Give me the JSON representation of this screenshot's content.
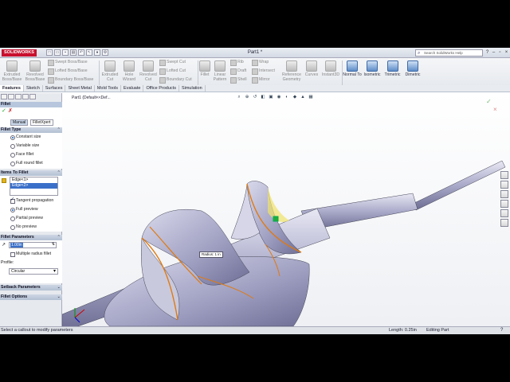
{
  "window": {
    "brand": "SOLIDWORKS",
    "doc_title": "Part1 *",
    "search_placeholder": "Search SolidWorks Help"
  },
  "ribbon": {
    "extruded_boss": "Extruded Boss/Base",
    "revolved_boss": "Revolved Boss/Base",
    "swept_boss": "Swept Boss/Base",
    "lofted_boss": "Lofted Boss/Base",
    "boundary_boss": "Boundary Boss/Base",
    "extruded_cut": "Extruded Cut",
    "hole_wizard": "Hole Wizard",
    "revolved_cut": "Revolved Cut",
    "swept_cut": "Swept Cut",
    "lofted_cut": "Lofted Cut",
    "boundary_cut": "Boundary Cut",
    "fillet": "Fillet",
    "linear_pattern": "Linear Pattern",
    "rib": "Rib",
    "draft": "Draft",
    "shell": "Shell",
    "wrap": "Wrap",
    "intersect": "Intersect",
    "mirror": "Mirror",
    "reference_geometry": "Reference Geometry",
    "curves": "Curves",
    "instant3d": "Instant3D",
    "normal_to": "Normal To",
    "isometric": "Isometric",
    "trimetric": "Trimetric",
    "dimetric": "Dimetric"
  },
  "tabs": [
    "Features",
    "Sketch",
    "Surfaces",
    "Sheet Metal",
    "Mold Tools",
    "Evaluate",
    "Office Products",
    "Simulation"
  ],
  "tree_label": "Part1 (Default<<Def...",
  "panel": {
    "title": "Fillet",
    "manual": "Manual",
    "filletxpert": "FilletXpert",
    "fillet_type": {
      "header": "Fillet Type",
      "options": [
        "Constant size",
        "Variable size",
        "Face fillet",
        "Full round fillet"
      ]
    },
    "items": {
      "header": "Items To Fillet",
      "edges": [
        "Edge<1>",
        "Edge<2>"
      ],
      "tangent": "Tangent propagation",
      "full_preview": "Full preview",
      "partial_preview": "Partial preview",
      "no_preview": "No preview"
    },
    "params": {
      "header": "Fillet Parameters",
      "radius": "1.00in",
      "multiple": "Multiple radius fillet",
      "profile_label": "Profile:",
      "profile": "Circular"
    },
    "setback": "Setback Parameters",
    "options": "Fillet Options"
  },
  "callout": "Radius: 1 in",
  "status": {
    "hint": "Select a callout to modify parameters",
    "length": "Length: 0.25in",
    "mode": "Editing Part"
  }
}
